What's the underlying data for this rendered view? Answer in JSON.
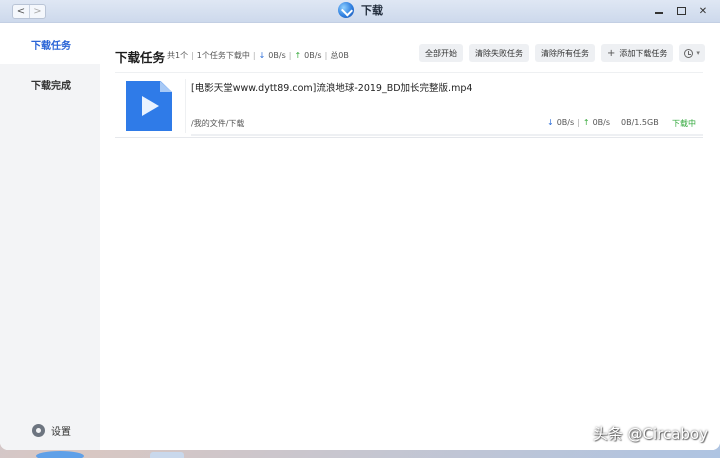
{
  "window": {
    "title": "下载",
    "back_label": "<",
    "forward_label": ">"
  },
  "sidebar": {
    "items": [
      {
        "label": "下载任务",
        "active": true
      },
      {
        "label": "下载完成",
        "active": false
      }
    ],
    "settings_label": "设置"
  },
  "header": {
    "title": "下载任务",
    "total_count": "共1个",
    "downloading_count": "1个任务下载中",
    "down_speed": "0B/s",
    "up_speed": "0B/s",
    "total_size": "总0B"
  },
  "toolbar": {
    "start_all": "全部开始",
    "clear_failed": "清除失败任务",
    "clear_all": "清除所有任务",
    "add_task": "添加下载任务"
  },
  "tasks": [
    {
      "name": "[电影天堂www.dytt89.com]流浪地球-2019_BD加长完整版.mp4",
      "path": "/我的文件/下载",
      "down_speed": "0B/s",
      "up_speed": "0B/s",
      "size": "0B/1.5GB",
      "status": "下载中",
      "progress": 0
    }
  ],
  "symbols": {
    "down_arrow": "↓",
    "up_arrow": "↑",
    "separator": "|"
  },
  "colors": {
    "accent": "#2a64d6",
    "status_green": "#2fa73a",
    "file_icon": "#2f7be8"
  },
  "watermark": "头条 @Circaboy"
}
